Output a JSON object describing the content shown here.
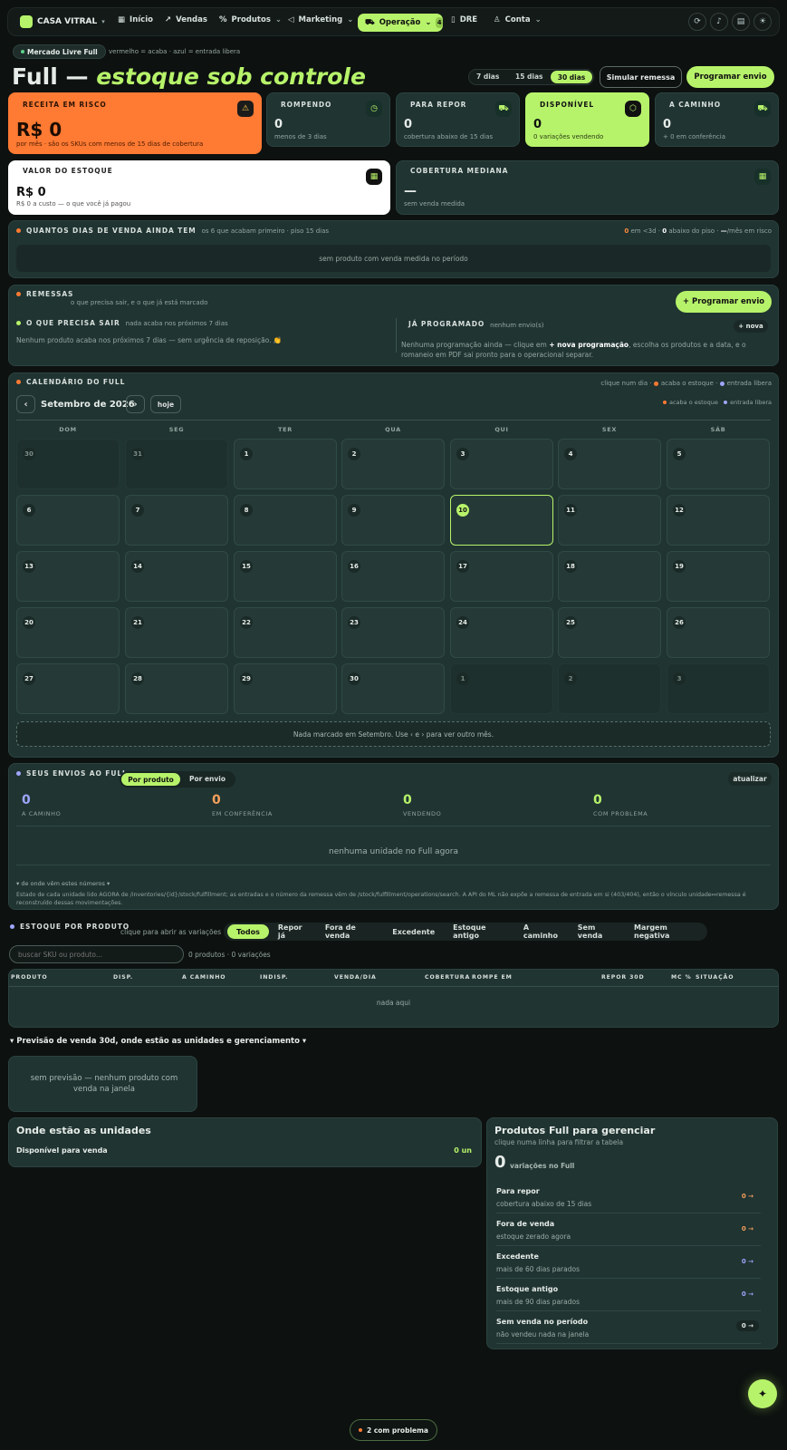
{
  "brand": {
    "name": "CASA VITRAL",
    "caret": "▾"
  },
  "nav": {
    "inicio": "Início",
    "vendas": "Vendas",
    "produtos": "Produtos",
    "marketing": "Marketing",
    "operacao": "Operação",
    "operacao_badge": "4",
    "dre": "DRE",
    "conta": "Conta",
    "caret": "⌄"
  },
  "header_icons": [
    "refresh-icon",
    "music-icon",
    "archive-icon",
    "sun-icon"
  ],
  "source_pill": "Mercado Livre Full",
  "legend_hint": "vermelho = acaba · azul = entrada libera",
  "title": {
    "main": "Full —",
    "accent": "estoque sob controle"
  },
  "ranges": [
    "7 dias",
    "15 dias",
    "30 dias"
  ],
  "actions": {
    "simular": "Simular remessa",
    "programar": "Programar envio"
  },
  "kpi": {
    "receita": {
      "label": "RECEITA EM RISCO",
      "value": "R$ 0",
      "sub": "por mês · são os SKUs com menos de 15 dias de cobertura"
    },
    "rompendo": {
      "label": "ROMPENDO",
      "value": "0",
      "sub": "menos de 3 dias"
    },
    "repor": {
      "label": "PARA REPOR",
      "value": "0",
      "sub": "cobertura abaixo de 15 dias"
    },
    "disponivel": {
      "label": "DISPONÍVEL",
      "value": "0",
      "sub": "0 variações vendendo"
    },
    "caminho": {
      "label": "A CAMINHO",
      "value": "0",
      "sub": "+ 0 em conferência"
    },
    "valor": {
      "label": "VALOR DO ESTOQUE",
      "value": "R$ 0",
      "sub": "R$ 0 a custo — o que você já pagou"
    },
    "cobertura": {
      "label": "COBERTURA MEDIANA",
      "value": "—",
      "sub": "sem venda medida"
    }
  },
  "dias": {
    "title": "QUANTOS DIAS DE VENDA AINDA TEM",
    "sub": "os 6 que acabam primeiro · piso 15 dias",
    "stats_a": "0",
    "stats_a_txt": " em <3d · ",
    "stats_b": "0",
    "stats_b_txt": " abaixo do piso · ",
    "stats_c": "—",
    "stats_c_txt": "/mês em risco",
    "empty": "sem produto com venda medida no período"
  },
  "remessas": {
    "title": "REMESSAS",
    "sub": "o que precisa sair, e o que já está marcado",
    "button": "+ Programar envio",
    "sair_title": "O QUE PRECISA SAIR",
    "sair_sub": "nada acaba nos próximos 7 dias",
    "sair_text": "Nenhum produto acaba nos próximos 7 dias — sem urgência de reposição. 👏",
    "prog_title": "JÁ PROGRAMADO",
    "prog_sub": "nenhum envio(s)",
    "prog_button": "+ nova",
    "prog_text_a": "Nenhuma programação ainda — clique em ",
    "prog_text_b": "+ nova programação",
    "prog_text_c": ", escolha os produtos e a data, e o romaneio em PDF sai pronto para o operacional separar."
  },
  "calendario": {
    "title": "CALENDÁRIO DO FULL",
    "hint_a": "clique num dia · ",
    "hint_b": "acaba o estoque",
    "hint_c": " · ",
    "hint_d": "entrada libera",
    "month": "Setembro de 2026",
    "prev": "‹",
    "next": "›",
    "hoje": "hoje",
    "legend_a": "acaba o estoque",
    "legend_b": "entrada libera",
    "weekdays": [
      "DOM",
      "SEG",
      "TER",
      "QUA",
      "QUI",
      "SEX",
      "SÁB"
    ],
    "days": [
      "30",
      "31",
      "1",
      "2",
      "3",
      "4",
      "5",
      "6",
      "7",
      "8",
      "9",
      "10",
      "11",
      "12",
      "13",
      "14",
      "15",
      "16",
      "17",
      "18",
      "19",
      "20",
      "21",
      "22",
      "23",
      "24",
      "25",
      "26",
      "27",
      "28",
      "29",
      "30",
      "1",
      "2",
      "3"
    ],
    "empty": "Nada marcado em Setembro. Use ‹ e › para ver outro mês."
  },
  "envios": {
    "title": "SEUS ENVIOS AO FULL",
    "tab_a": "Por produto",
    "tab_b": "Por envio",
    "refresh": "atualizar",
    "stats": [
      {
        "n": "0",
        "c": "A CAMINHO",
        "color": "#9ea7ff"
      },
      {
        "n": "0",
        "c": "EM CONFERÊNCIA",
        "color": "#f5a05a"
      },
      {
        "n": "0",
        "c": "VENDENDO",
        "color": "#b7f36a"
      },
      {
        "n": "0",
        "c": "COM PROBLEMA",
        "color": "#b7f36a"
      }
    ],
    "empty": "nenhuma unidade no Full agora",
    "note_title": "▾ de onde vêm estes números ▾",
    "note": "Estado de cada unidade lido AGORA de /inventories/{id}/stock/fulfillment; as entradas e o número da remessa vêm de /stock/fulfillment/operations/search. A API do ML não expõe a remessa de entrada em si (403/404), então o vínculo unidade↔remessa é reconstruído dessas movimentações."
  },
  "estoque": {
    "title": "ESTOQUE POR PRODUTO",
    "sub": "clique para abrir as variações",
    "filters": [
      "Todos",
      "Repor já",
      "Fora de venda",
      "Excedente",
      "Estoque antigo",
      "A caminho",
      "Sem venda",
      "Margem negativa"
    ],
    "search_placeholder": "buscar SKU ou produto...",
    "count": "0 produtos · 0 variações",
    "columns": [
      "PRODUTO",
      "DISP.",
      "A CAMINHO",
      "INDISP.",
      "VENDA/DIA",
      "COBERTURA",
      "ROMPE EM",
      "REPOR 30D",
      "MC %",
      "SITUAÇÃO"
    ],
    "empty": "nada aqui"
  },
  "previsao": {
    "toggle": "▾ Previsão de venda 30d, onde estão as unidades e gerenciamento ▾",
    "empty": "sem previsão — nenhum produto com venda na janela"
  },
  "unidades": {
    "title": "Onde estão as unidades",
    "row_label": "Disponível para venda",
    "row_value": "0 un"
  },
  "gerenciar": {
    "title": "Produtos Full para gerenciar",
    "sub": "clique numa linha para filtrar a tabela",
    "count": "0",
    "count_label": "variações no Full",
    "rows": [
      {
        "t": "Para repor",
        "s": "cobertura abaixo de 15 dias",
        "v": "0 →",
        "color": "#f5a05a"
      },
      {
        "t": "Fora de venda",
        "s": "estoque zerado agora",
        "v": "0 →",
        "color": "#f5a05a"
      },
      {
        "t": "Excedente",
        "s": "mais de 60 dias parados",
        "v": "0 →",
        "color": "#9ea7ff"
      },
      {
        "t": "Estoque antigo",
        "s": "mais de 90 dias parados",
        "v": "0 →",
        "color": "#9ea7ff"
      },
      {
        "t": "Sem venda no período",
        "s": "não vendeu nada na janela",
        "v": "0 →",
        "color": "#d7dfdb"
      }
    ]
  },
  "toast": "2 com problema",
  "fab": "✦"
}
